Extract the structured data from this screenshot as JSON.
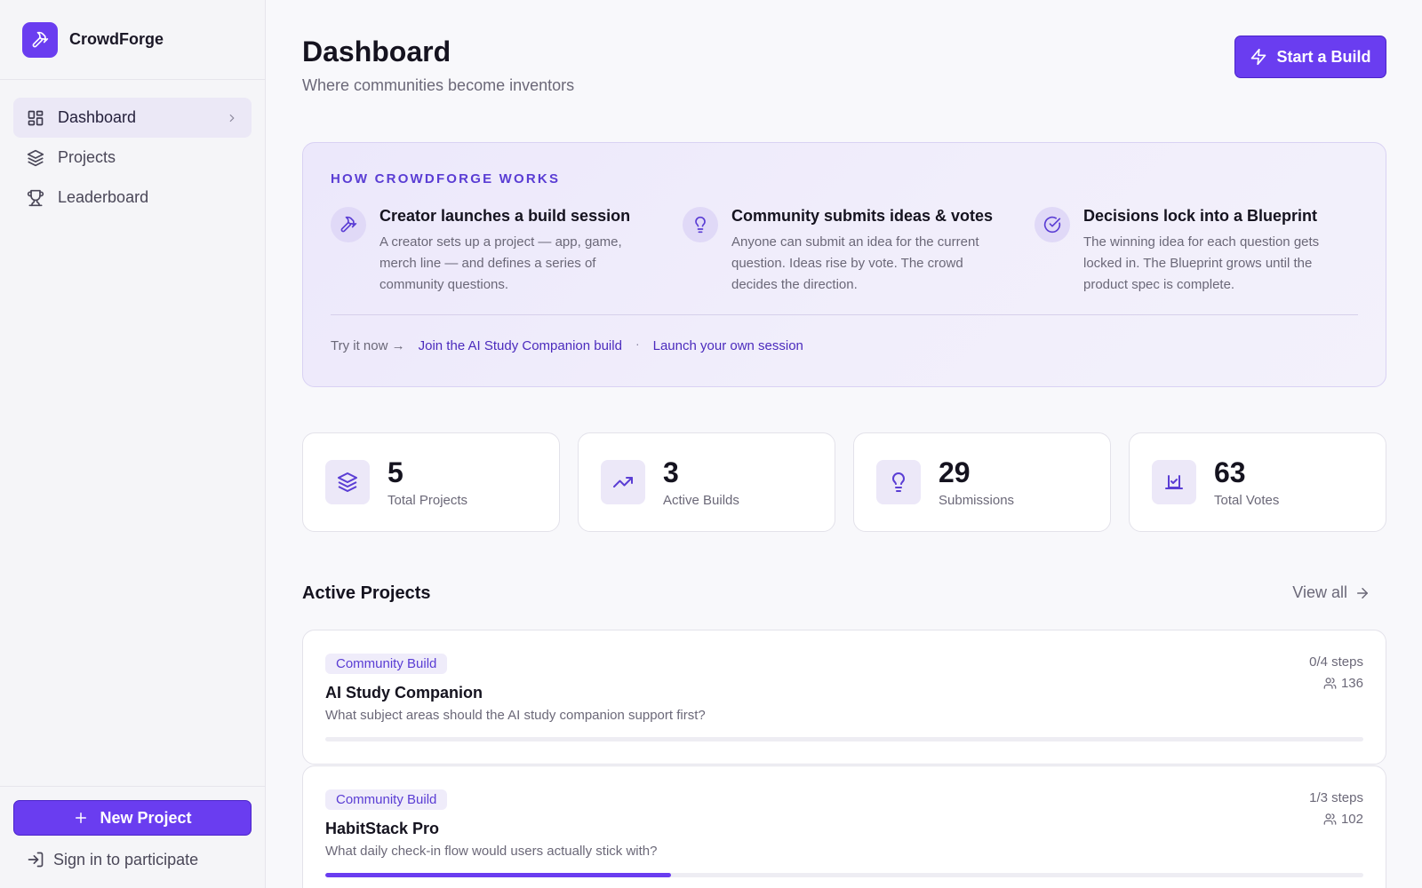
{
  "brand": {
    "name": "CrowdForge"
  },
  "sidebar": {
    "items": [
      {
        "label": "Dashboard",
        "icon": "dashboard-grid-icon",
        "active": true
      },
      {
        "label": "Projects",
        "icon": "layers-icon",
        "active": false
      },
      {
        "label": "Leaderboard",
        "icon": "trophy-icon",
        "active": false
      }
    ],
    "new_project_label": "New Project",
    "signin_label": "Sign in to participate"
  },
  "header": {
    "title": "Dashboard",
    "subtitle": "Where communities become inventors",
    "start_build_label": "Start a Build"
  },
  "how": {
    "label": "HOW CROWDFORGE WORKS",
    "steps": [
      {
        "title": "Creator launches a build session",
        "desc": "A creator sets up a project — app, game, merch line — and defines a series of community questions.",
        "icon": "hammer-icon"
      },
      {
        "title": "Community submits ideas & votes",
        "desc": "Anyone can submit an idea for the current question. Ideas rise by vote. The crowd decides the direction.",
        "icon": "lightbulb-icon"
      },
      {
        "title": "Decisions lock into a Blueprint",
        "desc": "The winning idea for each question gets locked in. The Blueprint grows until the product spec is complete.",
        "icon": "check-circle-icon"
      }
    ],
    "tryit_label": "Try it now →",
    "link_join": "Join the AI Study Companion build",
    "separator": "·",
    "link_launch": "Launch your own session"
  },
  "stats": [
    {
      "value": "5",
      "label": "Total Projects",
      "icon": "layers-icon"
    },
    {
      "value": "3",
      "label": "Active Builds",
      "icon": "trending-up-icon"
    },
    {
      "value": "29",
      "label": "Submissions",
      "icon": "lightbulb-icon"
    },
    {
      "value": "63",
      "label": "Total Votes",
      "icon": "vote-box-icon"
    }
  ],
  "active_projects": {
    "title": "Active Projects",
    "view_all_label": "View all",
    "items": [
      {
        "badge": "Community Build",
        "name": "AI Study Companion",
        "question": "What subject areas should the AI study companion support first?",
        "steps": "0/4 steps",
        "members": "136",
        "progress": 0
      },
      {
        "badge": "Community Build",
        "name": "HabitStack Pro",
        "question": "What daily check-in flow would users actually stick with?",
        "steps": "1/3 steps",
        "members": "102",
        "progress": 0.333
      }
    ]
  },
  "colors": {
    "accent": "#6a3df0",
    "accent_dark": "#4b24c9",
    "link": "#4b2bbd"
  }
}
